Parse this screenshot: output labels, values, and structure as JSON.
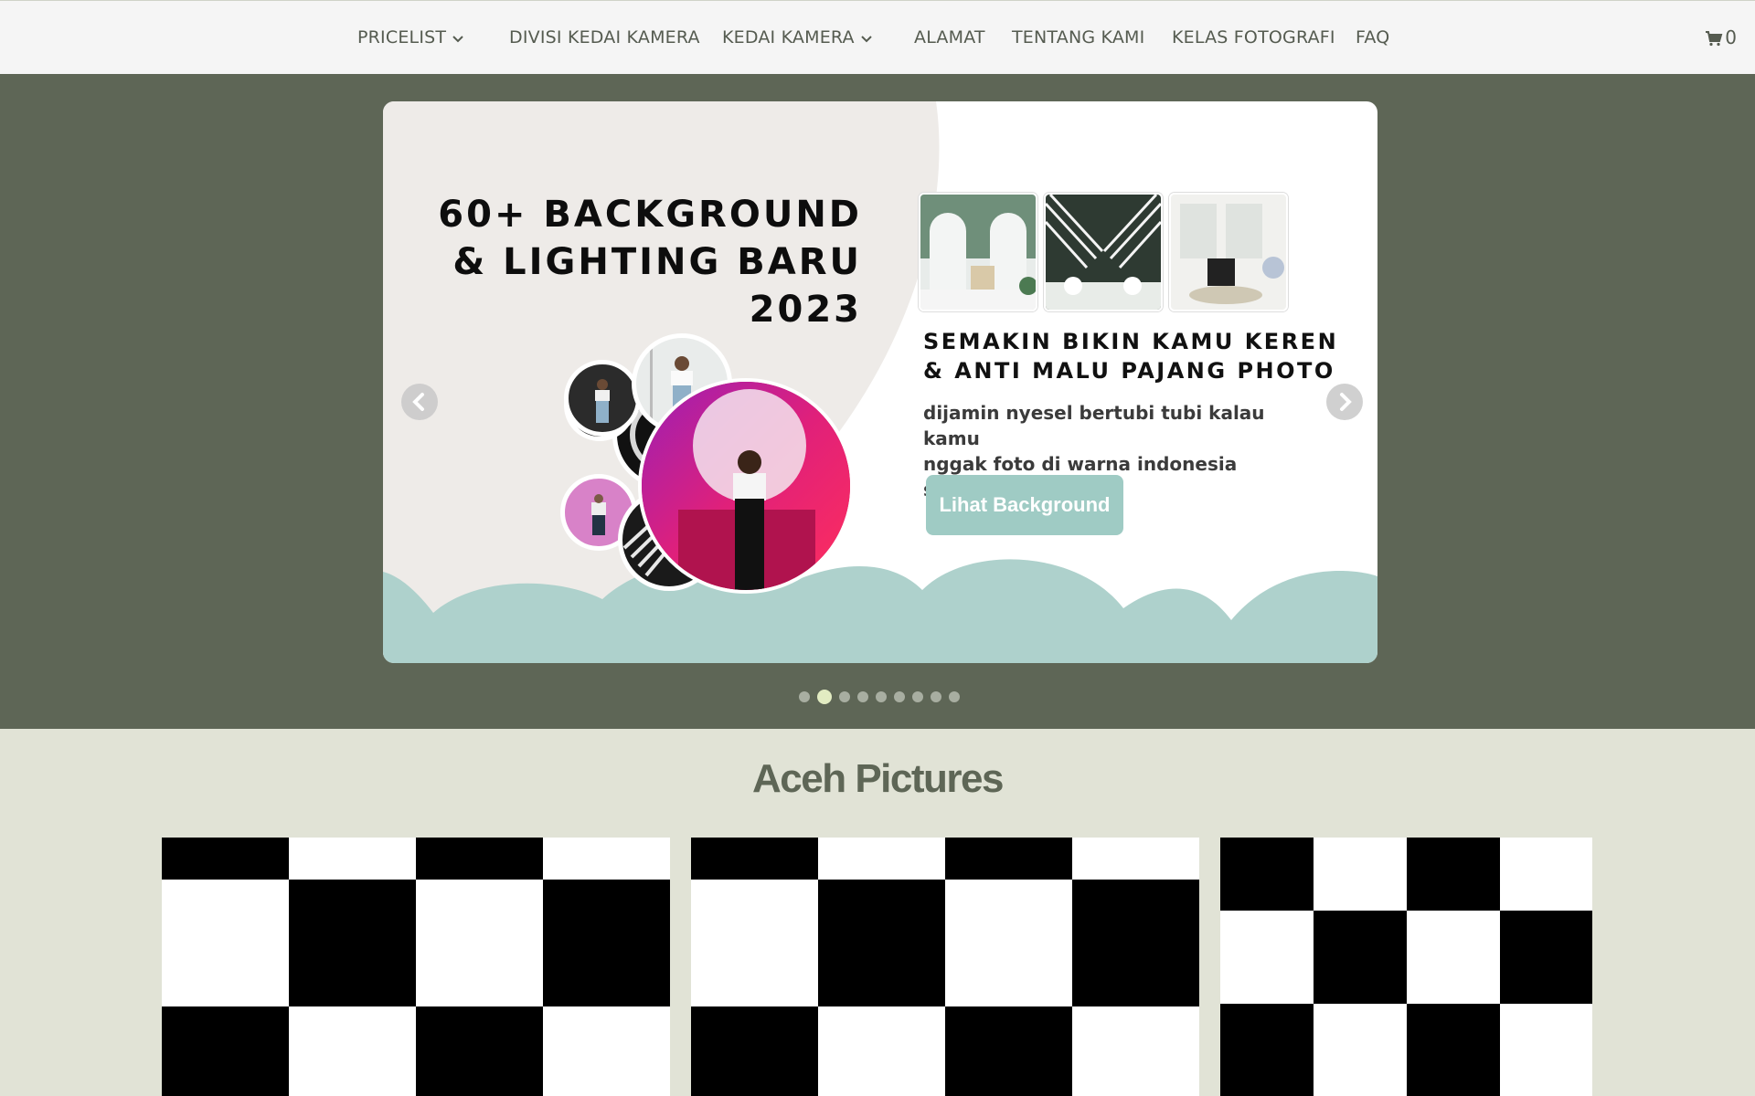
{
  "nav": {
    "items": [
      {
        "label": "PRICELIST",
        "has_dropdown": true
      },
      {
        "label": "DIVISI KEDAI KAMERA",
        "has_dropdown": false
      },
      {
        "label": "KEDAI KAMERA",
        "has_dropdown": true
      },
      {
        "label": "ALAMAT",
        "has_dropdown": false
      },
      {
        "label": "TENTANG KAMI",
        "has_dropdown": false
      },
      {
        "label": "KELAS FOTOGRAFI",
        "has_dropdown": false
      },
      {
        "label": "FAQ",
        "has_dropdown": false
      }
    ],
    "cart_icon": "shopping-cart-icon",
    "cart_count": "0"
  },
  "hero": {
    "headline": "60+ BACKGROUND\n& LIGHTING BARU\n2023",
    "subheadline": "SEMAKIN BIKIN KAMU KEREN\n&  ANTI MALU PAJANG PHOTO",
    "description": "dijamin nyesel bertubi tubi kalau kamu\nnggak foto di warna indonesia studio",
    "cta_label": "Lihat Background",
    "prev_icon": "chevron-left-icon",
    "next_icon": "chevron-right-icon",
    "slide_count": 9,
    "active_slide": 2,
    "colors": {
      "band": "#5e6656",
      "cream": "#eeebe8",
      "mint": "#aed1cc",
      "cta": "#9fcbc4"
    }
  },
  "gallery": {
    "title": "Aceh Pictures",
    "tile_count": 3
  }
}
